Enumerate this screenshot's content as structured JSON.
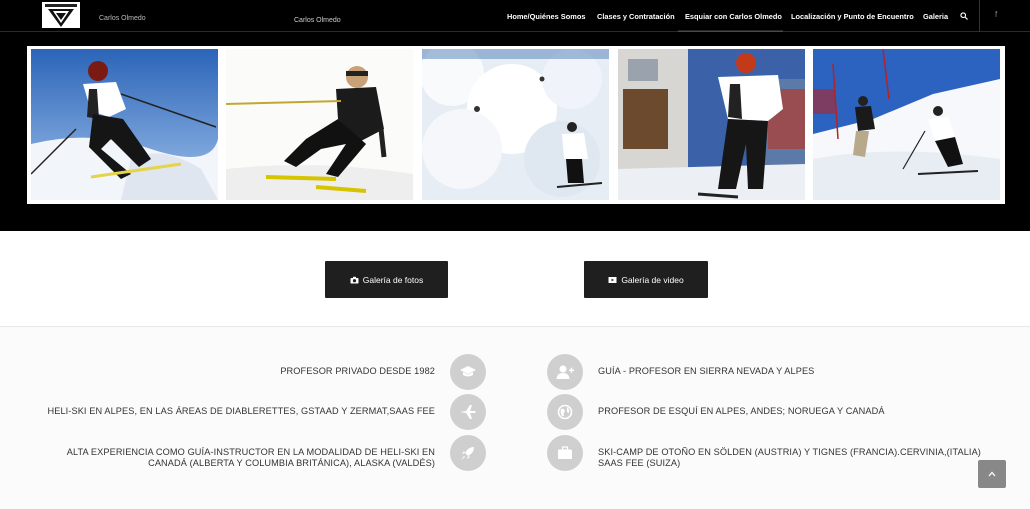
{
  "header": {
    "brand_name": "Carlos Olmedo",
    "sub_brand": "Carlos Olmedo",
    "nav": [
      {
        "label": "Home/Quiénes Somos"
      },
      {
        "label": "Clases y Contratación"
      },
      {
        "label": "Esquiar con Carlos Olmedo"
      },
      {
        "label": "Localización y Punto de Encuentro"
      },
      {
        "label": "Galeria"
      }
    ],
    "social_label": "f"
  },
  "gallery": {
    "photos": [
      {
        "subject": "skier carving in red jacket"
      },
      {
        "subject": "skier in black suit turning"
      },
      {
        "subject": "skier in powder snow"
      },
      {
        "subject": "skier near chalet"
      },
      {
        "subject": "two skiers on slope"
      }
    ]
  },
  "buttons": {
    "photo_gallery": "Galería de fotos",
    "video_gallery": "Galería de video"
  },
  "features": {
    "left": [
      {
        "text": "PROFESOR PRIVADO DESDE 1982",
        "icon": "graduation-cap-icon"
      },
      {
        "text": "HELI-SKI EN ALPES, EN LAS ÁREAS DE DIABLERETTES, GSTAAD Y ZERMAT,SAAS FEE",
        "icon": "plane-icon"
      },
      {
        "line1": "ALTA EXPERIENCIA COMO GUÍA-INSTRUCTOR EN LA MODALIDAD DE HELI-SKI EN",
        "line2": "CANADÁ (ALBERTA Y COLUMBIA BRITÁNICA), ALASKA (VALDÉS)",
        "icon": "rocket-icon"
      }
    ],
    "right": [
      {
        "text": "GUÍA - PROFESOR EN SIERRA NEVADA Y ALPES",
        "icon": "add-user-icon"
      },
      {
        "text": "PROFESOR DE ESQUÍ EN ALPES, ANDES; NORUEGA Y CANADÁ",
        "icon": "globe-icon"
      },
      {
        "line1": "SKI-CAMP DE OTOÑO EN SÖLDEN (AUSTRIA) Y TIGNES (FRANCIA).CERVINIA,(ITALIA)",
        "line2": "SAAS FEE (SUIZA)",
        "icon": "briefcase-icon"
      }
    ]
  },
  "colors": {
    "header_bg": "#000000",
    "button_bg": "#1f1f1f",
    "icon_circle": "#cfcfcf"
  }
}
